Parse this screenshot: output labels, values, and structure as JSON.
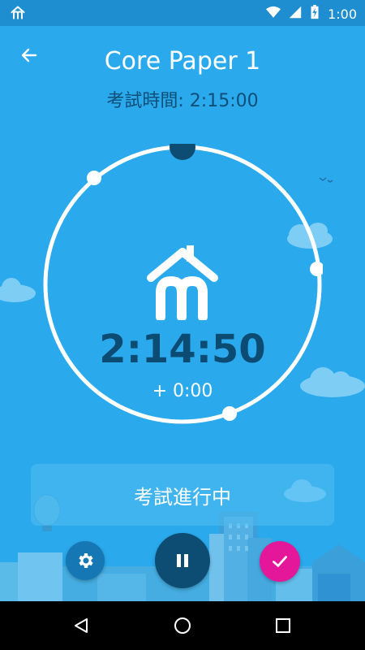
{
  "status_bar": {
    "time": "1:00"
  },
  "header": {
    "title": "Core Paper 1",
    "subtitle": "考試時間: 2:15:00"
  },
  "timer": {
    "remaining": "2:14:50",
    "offset": "+ 0:00"
  },
  "status_panel": {
    "label": "考試進行中"
  },
  "colors": {
    "background": "#2aa9ec",
    "dark_blue": "#0e4d73",
    "accent_pink": "#e4169a"
  },
  "icons": {
    "back": "arrow-left-icon",
    "logo": "home-m-logo-icon",
    "settings": "gear-icon",
    "pause": "pause-icon",
    "done": "check-icon"
  }
}
